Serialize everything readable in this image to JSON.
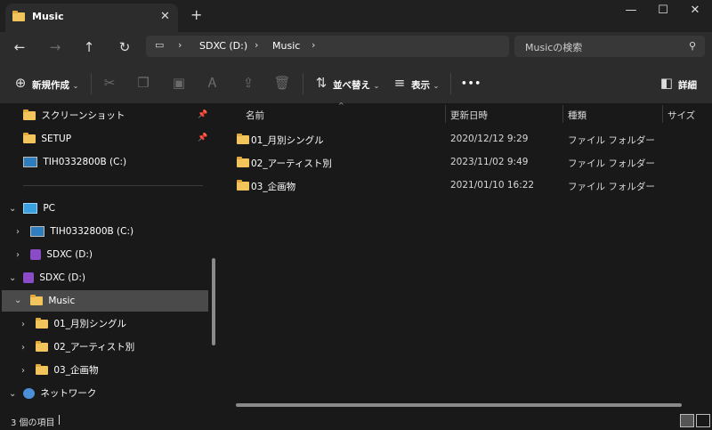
{
  "window": {
    "tab_title": "Music",
    "tab_close": "✕",
    "new_tab": "+",
    "minimize": "—",
    "maximize": "☐",
    "close": "✕"
  },
  "address": {
    "crumbs": [
      "SDXC (D:)",
      "Music"
    ],
    "search_placeholder": "Musicの検索"
  },
  "toolbar": {
    "new_label": "新規作成",
    "sort_label": "並べ替え",
    "view_label": "表示",
    "more_label": "•••",
    "details_label": "詳細"
  },
  "nav": {
    "quick": [
      {
        "label": "スクリーンショット",
        "icon": "folder-icon",
        "pinned": true
      },
      {
        "label": "SETUP",
        "icon": "folder-icon",
        "pinned": true
      },
      {
        "label": "TIH0332800B (C:)",
        "icon": "drive-icon",
        "pinned": false
      }
    ],
    "pc_label": "PC",
    "pc_children": [
      "TIH0332800B (C:)",
      "SDXC (D:)"
    ],
    "sdxc_label": "SDXC (D:)",
    "music_label": "Music",
    "music_children": [
      "01_月別シングル",
      "02_アーティスト別",
      "03_企画物"
    ],
    "network_label": "ネットワーク"
  },
  "columns": {
    "name": "名前",
    "modified": "更新日時",
    "type": "種類",
    "size": "サイズ"
  },
  "files": [
    {
      "name": "01_月別シングル",
      "modified": "2020/12/12 9:29",
      "type": "ファイル フォルダー"
    },
    {
      "name": "02_アーティスト別",
      "modified": "2023/11/02 9:49",
      "type": "ファイル フォルダー"
    },
    {
      "name": "03_企画物",
      "modified": "2021/01/10 16:22",
      "type": "ファイル フォルダー"
    }
  ],
  "status": {
    "item_count": "3 個の項目"
  },
  "colors": {
    "background": "#191919",
    "chrome": "#2c2c2c",
    "selection": "#4a4a4a",
    "folder": "#f2c55c"
  }
}
